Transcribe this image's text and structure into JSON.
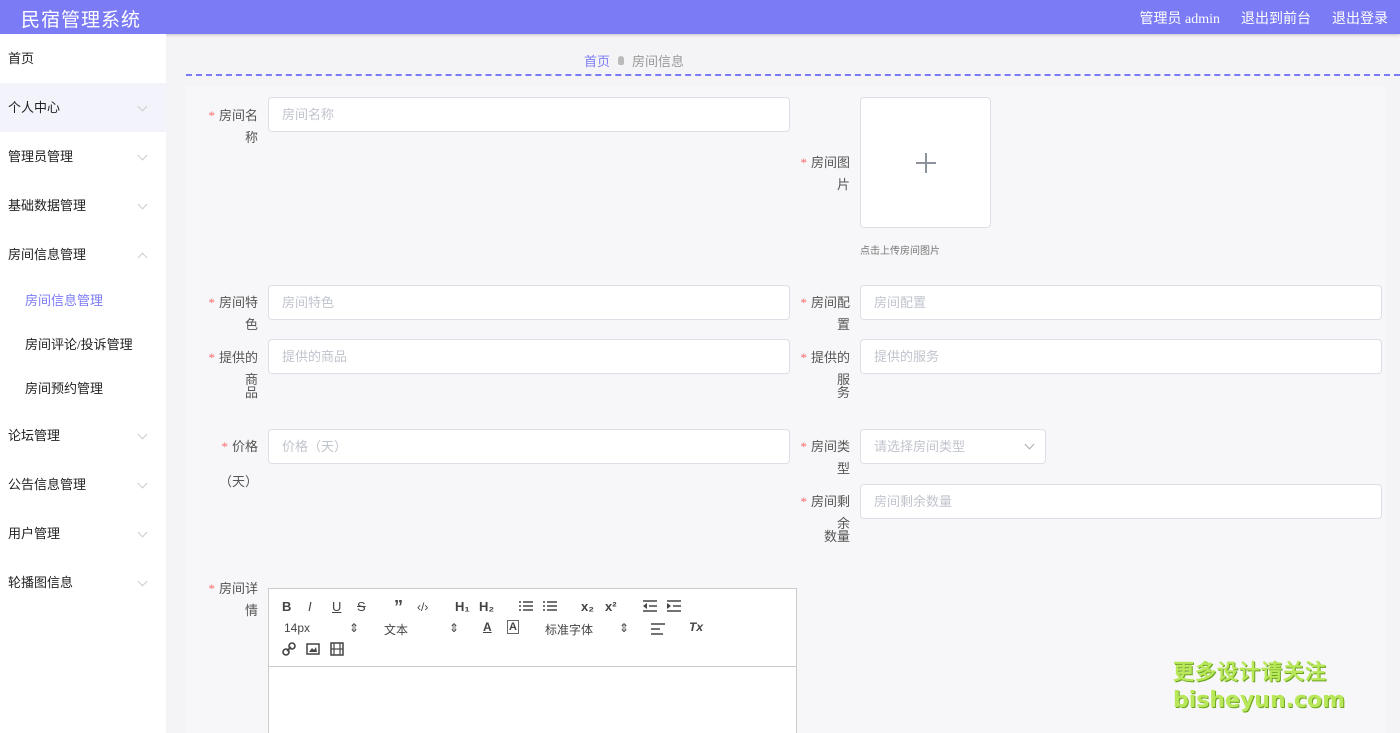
{
  "app": {
    "title": "民宿管理系统",
    "admin_label": "管理员 admin",
    "back_to_front": "退出到前台",
    "logout": "退出登录",
    "accent": "#7b7bf6"
  },
  "sidebar": {
    "home": "首页",
    "items": [
      {
        "label": "个人中心"
      },
      {
        "label": "管理员管理"
      },
      {
        "label": "基础数据管理"
      },
      {
        "label": "房间信息管理"
      },
      {
        "label": "论坛管理"
      },
      {
        "label": "公告信息管理"
      },
      {
        "label": "用户管理"
      },
      {
        "label": "轮播图信息"
      }
    ],
    "submenu": [
      "房间信息管理",
      "房间评论/投诉管理",
      "房间预约管理"
    ]
  },
  "breadcrumb": {
    "home": "首页",
    "current": "房间信息"
  },
  "form": {
    "room_name": {
      "label": "房间名称",
      "placeholder": "房间名称"
    },
    "room_image": {
      "label": "房间图片",
      "hint": "点击上传房间图片"
    },
    "room_feature": {
      "label": "房间特色",
      "placeholder": "房间特色"
    },
    "room_config": {
      "label": "房间配置",
      "placeholder": "房间配置"
    },
    "goods": {
      "label_a": "提供的商",
      "label_b": "品",
      "placeholder": "提供的商品"
    },
    "services": {
      "label_a": "提供的服",
      "label_b": "务",
      "placeholder": "提供的服务"
    },
    "price": {
      "label_a": "价格",
      "label_b": "（天）",
      "placeholder": "价格（天）"
    },
    "room_type": {
      "label": "房间类型",
      "placeholder": "请选择房间类型"
    },
    "remaining": {
      "label_a": "房间剩余",
      "label_b": "数量",
      "placeholder": "房间剩余数量"
    },
    "details": {
      "label": "房间详情"
    },
    "required_mark": "*"
  },
  "editor": {
    "font_size": "14px",
    "text_type": "文本",
    "font_family": "标准字体",
    "buttons": [
      "B",
      "I",
      "U",
      "S",
      "”",
      "‹/›",
      "H₁",
      "H₂",
      "x₂",
      "x²",
      "A",
      "A",
      "Tx"
    ]
  },
  "watermark": {
    "line1": "更多设计请关注",
    "line2": "bisheyun.com"
  }
}
